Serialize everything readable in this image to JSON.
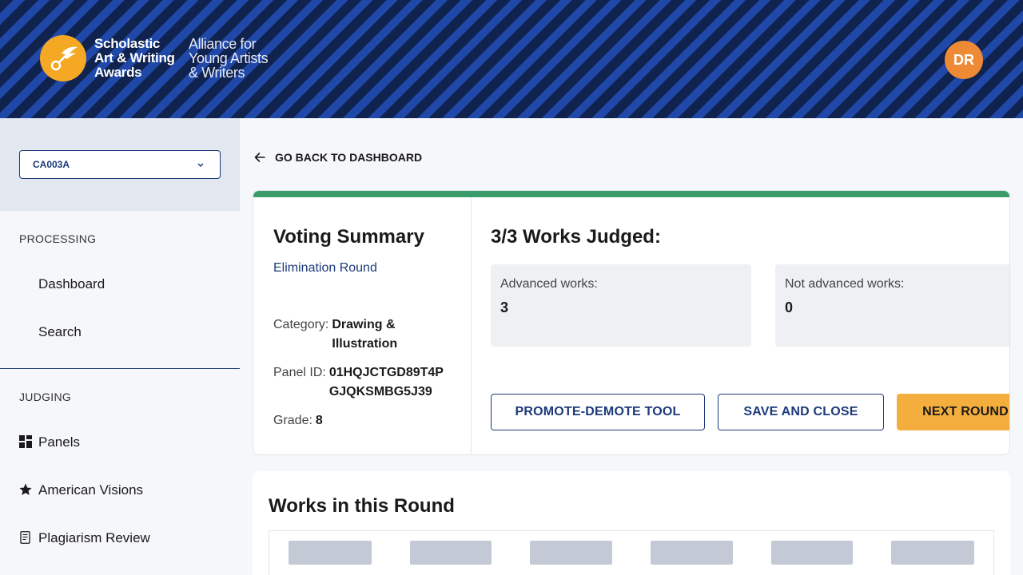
{
  "header": {
    "logo_main": [
      "Scholastic",
      "Art & Writing",
      "Awards"
    ],
    "logo_sub": [
      "Alliance for",
      "Young Artists",
      "& Writers"
    ],
    "avatar_initials": "DR",
    "logo_color": "#f4a823",
    "avatar_color": "#ee8a35"
  },
  "sidebar": {
    "selected_code": "CA003A",
    "processing_label": "PROCESSING",
    "processing_items": [
      {
        "label": "Dashboard"
      },
      {
        "label": "Search"
      }
    ],
    "judging_label": "JUDGING",
    "judging_items": [
      {
        "label": "Panels",
        "icon": "grid-icon"
      },
      {
        "label": "American Visions",
        "icon": "star-icon"
      },
      {
        "label": "Plagiarism Review",
        "icon": "document-icon"
      }
    ]
  },
  "main": {
    "back_label": "GO BACK TO DASHBOARD",
    "summary": {
      "title": "Voting Summary",
      "round": "Elimination Round",
      "category_label": "Category:",
      "category_value": [
        "Drawing &",
        "Illustration"
      ],
      "panel_label": "Panel ID:",
      "panel_value": [
        "01HQJCTGD89T4P",
        "GJQKSMBG5J39"
      ],
      "grade_label": "Grade:",
      "grade_value": "8"
    },
    "judged": {
      "title": "3/3 Works Judged:",
      "advanced_label": "Advanced works:",
      "advanced_value": "3",
      "not_advanced_label": "Not advanced works:",
      "not_advanced_value": "0"
    },
    "buttons": {
      "promote_demote": "PROMOTE-DEMOTE TOOL",
      "save_close": "SAVE AND CLOSE",
      "next_round": "NEXT ROUND"
    },
    "works": {
      "title": "Works in this Round"
    },
    "accent_green": "#3a9c6b",
    "accent_navy": "#1c3a7a",
    "accent_orange": "#f4ae3d"
  }
}
